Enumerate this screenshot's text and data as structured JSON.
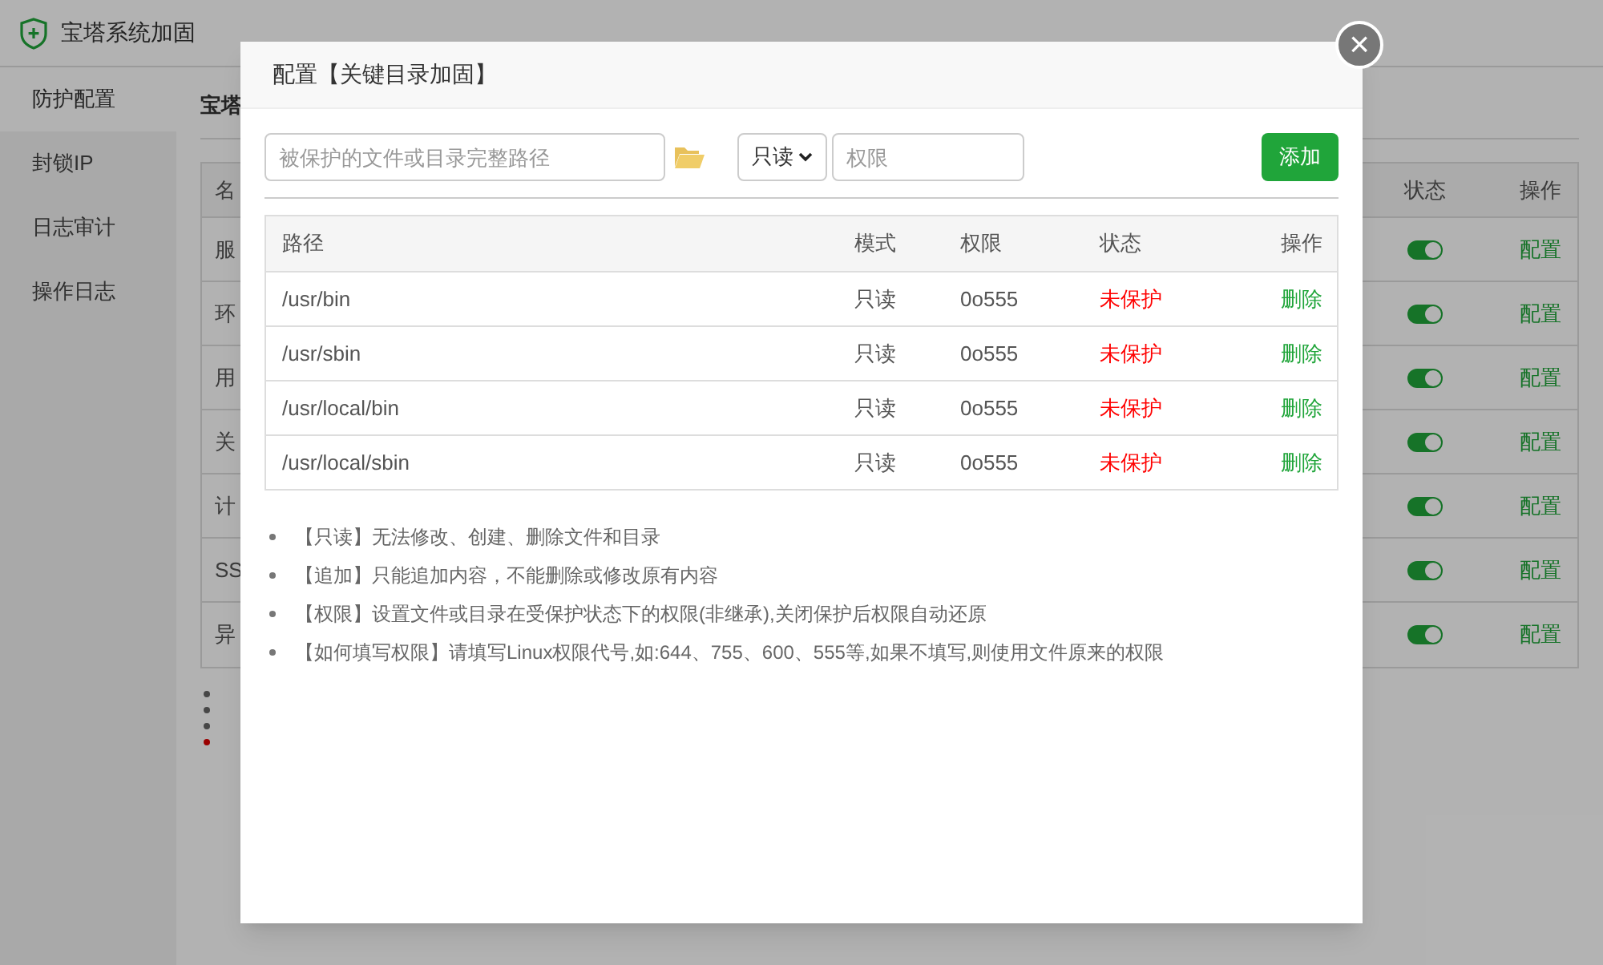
{
  "app": {
    "title": "宝塔系统加固"
  },
  "sidebar": {
    "items": [
      {
        "label": "防护配置",
        "selected": true
      },
      {
        "label": "封锁IP",
        "selected": false
      },
      {
        "label": "日志审计",
        "selected": false
      },
      {
        "label": "操作日志",
        "selected": false
      }
    ]
  },
  "content": {
    "heading": "宝塔",
    "table": {
      "columns": [
        "名",
        "状态",
        "操作"
      ],
      "rows": [
        {
          "name": "服",
          "on": true,
          "action": "配置"
        },
        {
          "name": "环",
          "on": true,
          "action": "配置"
        },
        {
          "name": "用",
          "on": true,
          "action": "配置"
        },
        {
          "name": "关",
          "on": true,
          "action": "配置"
        },
        {
          "name": "计",
          "on": true,
          "action": "配置"
        },
        {
          "name": "SS",
          "on": true,
          "action": "配置"
        },
        {
          "name": "异",
          "on": true,
          "action": "配置"
        }
      ]
    },
    "notes": [
      {
        "kind": "normal"
      },
      {
        "kind": "normal"
      },
      {
        "kind": "normal"
      },
      {
        "kind": "warning"
      }
    ]
  },
  "dialog": {
    "title": "配置【关键目录加固】",
    "close": "×",
    "path_field": {
      "placeholder": "被保护的文件或目录完整路径"
    },
    "mode_select": {
      "value": "只读"
    },
    "permission_field": {
      "placeholder": "权限"
    },
    "add_button": "添加",
    "table": {
      "columns": [
        "路径",
        "模式",
        "权限",
        "状态",
        "操作"
      ],
      "rows": [
        {
          "path": "/usr/bin",
          "mode": "只读",
          "permission": "0o555",
          "status": "未保护",
          "protected": false,
          "action": "删除"
        },
        {
          "path": "/usr/sbin",
          "mode": "只读",
          "permission": "0o555",
          "status": "未保护",
          "protected": false,
          "action": "删除"
        },
        {
          "path": "/usr/local/bin",
          "mode": "只读",
          "permission": "0o555",
          "status": "未保护",
          "protected": false,
          "action": "删除"
        },
        {
          "path": "/usr/local/sbin",
          "mode": "只读",
          "permission": "0o555",
          "status": "未保护",
          "protected": false,
          "action": "删除"
        }
      ]
    },
    "notes": [
      "【只读】无法修改、创建、删除文件和目录",
      "【追加】只能追加内容，不能删除或修改原有内容",
      "【权限】设置文件或目录在受保护状态下的权限(非继承),关闭保护后权限自动还原",
      "【如何填写权限】请填写Linux权限代号,如:644、755、600、555等,如果不填写,则使用文件原来的权限"
    ]
  }
}
